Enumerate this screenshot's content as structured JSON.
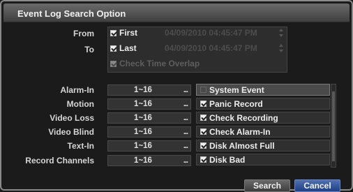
{
  "dialog": {
    "title": "Event Log Search Option",
    "from_label": "From",
    "to_label": "To",
    "from_check_label": "First",
    "from_datetime": "04/09/2010  04:45:47 PM",
    "to_check_label": "Last",
    "to_datetime": "04/09/2010  04:45:47 PM",
    "time_overlap_label": "Check Time Overlap",
    "fields": [
      {
        "label": "Alarm-In",
        "value": "1~16",
        "dots": "..."
      },
      {
        "label": "Motion",
        "value": "1~16",
        "dots": "..."
      },
      {
        "label": "Video Loss",
        "value": "1~16",
        "dots": "..."
      },
      {
        "label": "Video Blind",
        "value": "1~16",
        "dots": "..."
      },
      {
        "label": "Text-In",
        "value": "1~16",
        "dots": "..."
      },
      {
        "label": "Record Channels",
        "value": "1~16",
        "dots": "..."
      }
    ],
    "events": [
      {
        "label": "System Event",
        "checked": false
      },
      {
        "label": "Panic Record",
        "checked": true
      },
      {
        "label": "Check Recording",
        "checked": true
      },
      {
        "label": "Check Alarm-In",
        "checked": true
      },
      {
        "label": "Disk Almost Full",
        "checked": true
      },
      {
        "label": "Disk Bad",
        "checked": true
      }
    ],
    "buttons": {
      "search": "Search",
      "cancel": "Cancel"
    }
  },
  "colors": {
    "cancel_button": "#2a4a92",
    "background": "#1b1b1b",
    "disabled_text": "#4d4d4d"
  }
}
